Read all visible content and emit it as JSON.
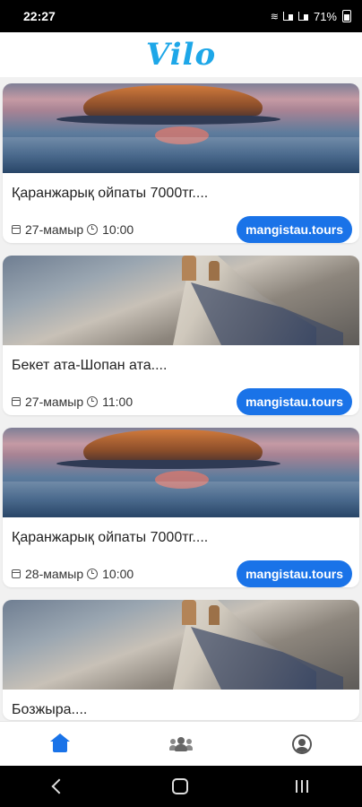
{
  "status_bar": {
    "time": "22:27",
    "battery": "71%"
  },
  "app": {
    "logo": "Vilo"
  },
  "cards": [
    {
      "title": "Қаранжарық ойпаты  7000тг....",
      "date": "27-мамыр",
      "time": "10:00",
      "tag": "mangistau.tours",
      "image": "lake-island"
    },
    {
      "title": "Бекет ата-Шопан ата....",
      "date": "27-мамыр",
      "time": "11:00",
      "tag": "mangistau.tours",
      "image": "canyon-cliffs"
    },
    {
      "title": "Қаранжарық ойпаты  7000тг....",
      "date": "28-мамыр",
      "time": "10:00",
      "tag": "mangistau.tours",
      "image": "lake-island"
    },
    {
      "title": "Бозжыра....",
      "image": "canyon-cliffs"
    }
  ],
  "bottom_nav": [
    {
      "name": "home",
      "icon": "home-icon",
      "active": true
    },
    {
      "name": "people",
      "icon": "people-icon",
      "active": false
    },
    {
      "name": "account",
      "icon": "account-icon",
      "active": false
    }
  ],
  "colors": {
    "accent": "#1a73e8",
    "logo": "#1ea7e8"
  }
}
